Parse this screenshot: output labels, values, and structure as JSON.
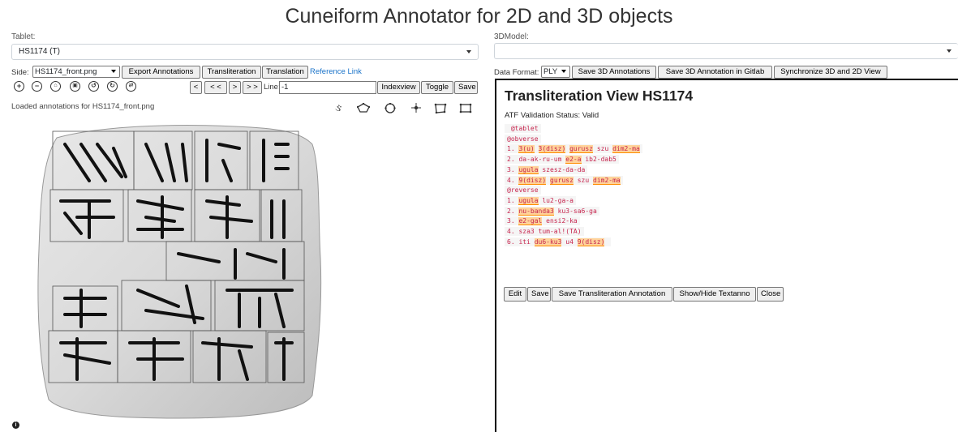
{
  "app": {
    "title": "Cuneiform Annotator for 2D and 3D objects"
  },
  "left": {
    "tablet_label": "Tablet:",
    "tablet_value": "HS1174 (T)",
    "side_label": "Side:",
    "side_value": "HS1174_front.png",
    "buttons": {
      "export": "Export Annotations",
      "transliteration": "Transliteration",
      "translation": "Translation"
    },
    "reference_link": "Reference Link",
    "nav": {
      "prev": "<",
      "first": "< <",
      "next": ">",
      "last": "> >"
    },
    "line_label": "Line:",
    "line_value": "-1",
    "indexview": "Indexview",
    "toggle": "Toggle",
    "save": "Save",
    "status": "Loaded annotations for HS1174_front.png",
    "info_icon": "i"
  },
  "right": {
    "model_label": "3DModel:",
    "model_value": "",
    "format_label": "Data Format:",
    "format_value": "PLY",
    "buttons": {
      "save3d": "Save 3D Annotations",
      "savegitlab": "Save 3D Annotation in Gitlab",
      "sync": "Synchronize 3D and 2D View"
    },
    "view_title": "Transliteration View HS1174",
    "atf_status": "ATF Validation Status: Valid",
    "atf_lines": [
      [
        {
          "t": " @tablet"
        }
      ],
      [
        {
          "t": "@obverse"
        }
      ],
      [
        {
          "t": "1. "
        },
        {
          "t": "3(u)",
          "h": true
        },
        {
          "t": " "
        },
        {
          "t": "3(disz)",
          "h": true
        },
        {
          "t": " "
        },
        {
          "t": "gurusz",
          "h": true
        },
        {
          "t": " szu "
        },
        {
          "t": "dim2-ma",
          "h": true
        }
      ],
      [
        {
          "t": "2. da-ak-ru-um "
        },
        {
          "t": "e2-a",
          "h": true
        },
        {
          "t": " ib2-dab5"
        }
      ],
      [
        {
          "t": "3. "
        },
        {
          "t": "ugula",
          "h": true
        },
        {
          "t": " szesz-da-da"
        }
      ],
      [
        {
          "t": "4. "
        },
        {
          "t": "9(disz)",
          "h": true
        },
        {
          "t": " "
        },
        {
          "t": "gurusz",
          "h": true
        },
        {
          "t": " szu "
        },
        {
          "t": "dim2-ma",
          "h": true
        }
      ],
      [
        {
          "t": "@reverse"
        }
      ],
      [
        {
          "t": "1. "
        },
        {
          "t": "ugula",
          "h": true
        },
        {
          "t": " lu2-ga-a"
        }
      ],
      [
        {
          "t": "2. "
        },
        {
          "t": "nu-banda3",
          "h": true
        },
        {
          "t": " ku3-sa6-ga"
        }
      ],
      [
        {
          "t": "3. "
        },
        {
          "t": "e2-gal",
          "h": true
        },
        {
          "t": " ensi2-ka"
        }
      ],
      [
        {
          "t": "4. sza3 tum-al!(TA)"
        }
      ],
      [
        {
          "t": "6. iti "
        },
        {
          "t": "du6-ku3",
          "h": true
        },
        {
          "t": " u4 "
        },
        {
          "t": "9(disz)",
          "h": true
        },
        {
          "t": " "
        }
      ]
    ],
    "actions": {
      "edit": "Edit",
      "save": "Save",
      "save_anno": "Save Transliteration Annotation",
      "showhide": "Show/Hide Textanno",
      "close": "Close"
    }
  }
}
